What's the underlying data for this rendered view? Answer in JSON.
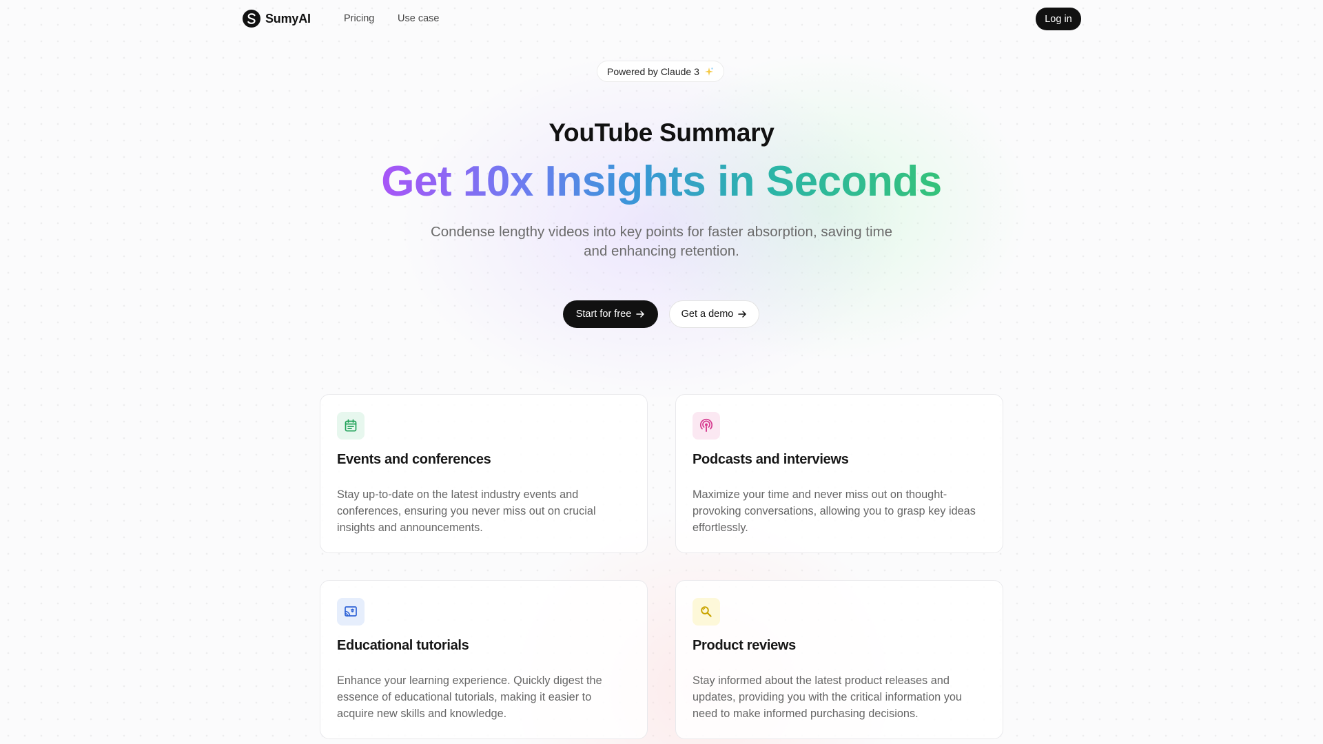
{
  "nav": {
    "brand": "SumyAI",
    "links": [
      "Pricing",
      "Use case"
    ],
    "login_label": "Log in"
  },
  "hero": {
    "badge": "Powered by Claude 3",
    "title": "YouTube Summary",
    "headline": "Get 10x Insights in Seconds",
    "subtitle": "Condense lengthy videos into key points for faster absorption, saving time and enhancing retention.",
    "primary_cta": "Start for free",
    "secondary_cta": "Get a demo"
  },
  "cards": [
    {
      "title": "Events and conferences",
      "description": "Stay up-to-date on the latest industry events and conferences, ensuring you never miss out on crucial insights and announcements.",
      "icon": "calendar-icon",
      "accent": "#22a35a",
      "tint": "#e7f7ee"
    },
    {
      "title": "Podcasts and interviews",
      "description": "Maximize your time and never miss out on thought-provoking conversations, allowing you to grasp key ideas effortlessly.",
      "icon": "podcast-icon",
      "accent": "#d63a8f",
      "tint": "#fbe8f2"
    },
    {
      "title": "Educational tutorials",
      "description": "Enhance your learning experience. Quickly digest the essence of educational tutorials, making it easier to acquire new skills and knowledge.",
      "icon": "cast-screen-icon",
      "accent": "#2f63d6",
      "tint": "#e6eefc"
    },
    {
      "title": "Product reviews",
      "description": "Stay informed about the latest product releases and updates, providing you with the critical information you need to make informed purchasing decisions.",
      "icon": "search-magnifier-icon",
      "accent": "#c9a400",
      "tint": "#fdf8d9"
    }
  ],
  "colors": {
    "primary_button": "#111111",
    "headline_gradient": [
      "#a855f7",
      "#3a96d8",
      "#35c27a"
    ]
  }
}
